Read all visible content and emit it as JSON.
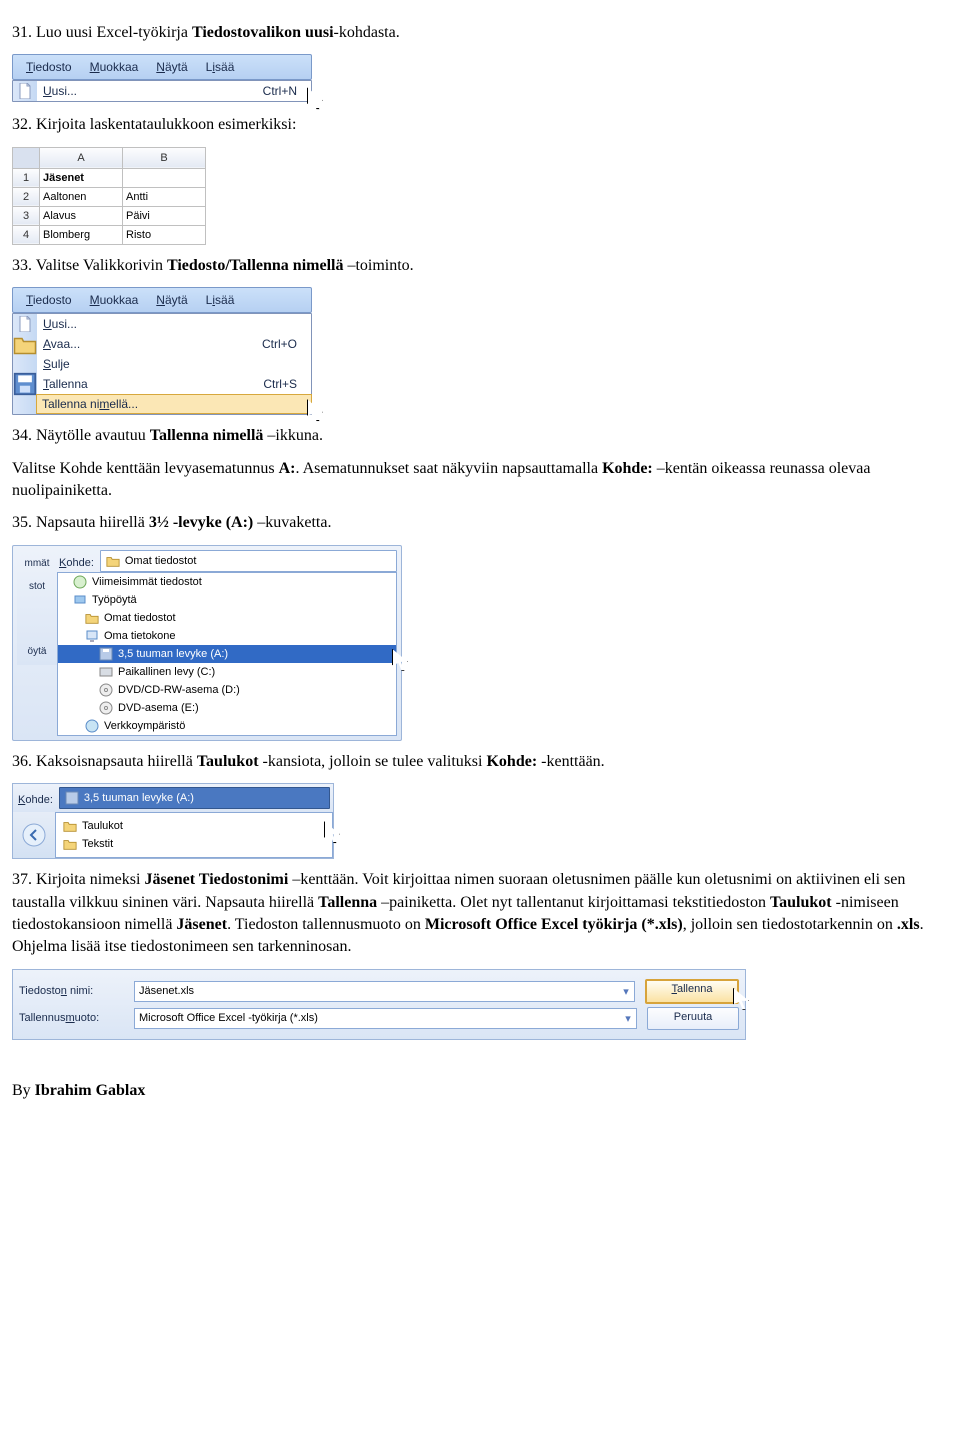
{
  "step31": {
    "text_pre": "31. Luo uusi Excel-työkirja ",
    "text_b1": "Tiedostovalikon uusi",
    "text_post": "-kohdasta."
  },
  "menubar": {
    "items": [
      "Tiedosto",
      "Muokkaa",
      "Näytä",
      "Lisää"
    ]
  },
  "menu_uusi": {
    "label": "Uusi...",
    "shortcut": "Ctrl+N"
  },
  "step32": "32. Kirjoita laskentataulukkoon esimerkiksi:",
  "grid": {
    "cols": [
      "A",
      "B"
    ],
    "rows": [
      [
        "Jäsenet",
        ""
      ],
      [
        "Aaltonen",
        "Antti"
      ],
      [
        "Alavus",
        "Päivi"
      ],
      [
        "Blomberg",
        "Risto"
      ]
    ]
  },
  "step33": {
    "pre": "33. Valitse Valikkorivin ",
    "b": "Tiedosto/Tallenna nimellä",
    "post": " –toiminto."
  },
  "menu_file": {
    "items": [
      {
        "label": "Uusi...",
        "sc": ""
      },
      {
        "label": "Avaa...",
        "sc": "Ctrl+O"
      },
      {
        "label": "Sulje",
        "sc": ""
      },
      {
        "label": "Tallenna",
        "sc": "Ctrl+S"
      },
      {
        "label": "Tallenna nimellä...",
        "sc": ""
      }
    ]
  },
  "step34": {
    "p1_pre": "34. Näytölle avautuu ",
    "p1_b": "Tallenna nimellä",
    "p1_post": " –ikkuna.",
    "p2": "Valitse Kohde kenttään levyasematunnus ",
    "p2_b": "A:",
    "p2_post": ". Asematunnukset saat näkyviin napsauttamalla ",
    "p2_b2": "Kohde:",
    "p2_post2": " –kentän oikeassa reunassa olevaa nuolipainiketta."
  },
  "step35": {
    "pre": "35. Napsauta hiirellä ",
    "b": "3½ -levyke (A:)",
    "post": " –kuvaketta."
  },
  "kohde": {
    "label": "Kohde:",
    "field_value": "Omat tiedostot",
    "side": [
      "mmät",
      "stot",
      "öytä"
    ],
    "items": [
      "Viimeisimmät tiedostot",
      "Työpöytä",
      "Omat tiedostot",
      "Oma tietokone",
      "3,5 tuuman levyke (A:)",
      "Paikallinen levy (C:)",
      "DVD/CD-RW-asema (D:)",
      "DVD-asema (E:)",
      "Verkkoympäristö"
    ],
    "selected_index": 4
  },
  "step36": {
    "pre": "36. Kaksoisnapsauta hiirellä ",
    "b": "Taulukot",
    "post": " -kansiota, jolloin se tulee valituksi ",
    "b2": "Kohde:",
    "post2": " -kenttään."
  },
  "kohde2": {
    "label": "Kohde:",
    "field_value": "3,5 tuuman levyke (A:)",
    "folders": [
      "Taulukot",
      "Tekstit"
    ]
  },
  "step37": {
    "pre": "37. Kirjoita nimeksi ",
    "b1": "Jäsenet Tiedostonimi",
    "mid1": " –kenttään. Voit kirjoittaa nimen suoraan oletusnimen päälle kun oletusnimi on aktiivinen eli sen taustalla vilkkuu sininen väri. Napsauta hiirellä ",
    "b2": "Tallenna",
    "mid2": " –painiketta. Olet nyt tallentanut kirjoittamasi tekstitiedoston ",
    "b3": "Taulukot",
    "mid3": " -nimiseen tiedostokansioon nimellä ",
    "b4": "Jäsenet",
    "mid4": ". Tiedoston tallennusmuoto on ",
    "b5": "Microsoft Office Excel työkirja (*.xls)",
    "mid5": ", jolloin sen tiedostotarkennin on ",
    "b6": ".xls",
    "mid6": ". Ohjelma lisää itse tiedostonimeen sen tarkenninosan."
  },
  "savedlg": {
    "name_label": "Tiedoston nimi:",
    "name_value": "Jäsenet.xls",
    "type_label": "Tallennusmuoto:",
    "type_value": "Microsoft Office Excel -työkirja (*.xls)",
    "btn_save": "Tallenna",
    "btn_cancel": "Peruuta"
  },
  "byline": {
    "pre": "By ",
    "b": "Ibrahim Gablax"
  }
}
